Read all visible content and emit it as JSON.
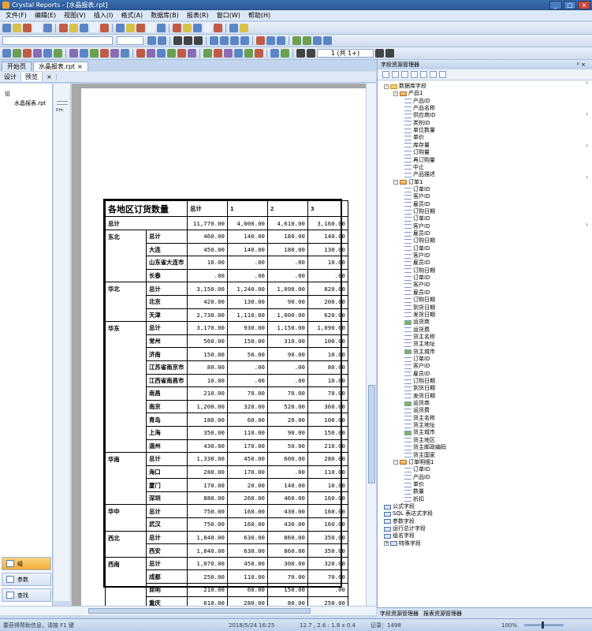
{
  "window": {
    "title": "Crystal Reports - [水晶报表.rpt]",
    "minimize": "_",
    "maximize": "□",
    "close": "×"
  },
  "menu": [
    "文件(F)",
    "编辑(E)",
    "视图(V)",
    "插入(I)",
    "格式(A)",
    "数据库(B)",
    "报表(R)",
    "窗口(W)",
    "帮助(H)"
  ],
  "doc_tabs": [
    {
      "label": "开始页",
      "active": false
    },
    {
      "label": "水晶报表.rpt",
      "active": true,
      "close": "×"
    }
  ],
  "sub_tabs": [
    {
      "label": "设计",
      "active": false
    },
    {
      "label": "预览",
      "active": true,
      "close": "×"
    }
  ],
  "page_nav": {
    "label": "1 (共 1+)"
  },
  "left_panel": {
    "heading": "组",
    "tree_item": "水晶报表.rpt",
    "buttons": [
      {
        "label": "组",
        "active": true
      },
      {
        "label": "参数",
        "active": false
      },
      {
        "label": "查找",
        "active": false
      }
    ]
  },
  "ruler_label": "RHc",
  "report": {
    "title": "各地区订货数量",
    "columns": [
      "总计",
      "1",
      "2",
      "3"
    ],
    "grand_total": {
      "label": "总计",
      "values": [
        "11,770.00",
        "4,000.00",
        "4,610.00",
        "3,160.00"
      ]
    },
    "regions": [
      {
        "name": "东北",
        "rows": [
          {
            "city": "总计",
            "values": [
              "460.00",
              "140.00",
              "180.00",
              "140.00"
            ]
          },
          {
            "city": "大连",
            "values": [
              "450.00",
              "140.00",
              "180.00",
              "130.00"
            ]
          },
          {
            "city": "山东省大连市",
            "values": [
              "10.00",
              ".00",
              ".00",
              "10.00"
            ]
          },
          {
            "city": "长春",
            "values": [
              ".00",
              ".00",
              ".00",
              ".00"
            ]
          }
        ]
      },
      {
        "name": "华北",
        "rows": [
          {
            "city": "总计",
            "values": [
              "3,150.00",
              "1,240.00",
              "1,090.00",
              "820.00"
            ]
          },
          {
            "city": "北京",
            "values": [
              "420.00",
              "130.00",
              "90.00",
              "200.00"
            ]
          },
          {
            "city": "天津",
            "values": [
              "2,730.00",
              "1,110.00",
              "1,000.00",
              "620.00"
            ]
          }
        ]
      },
      {
        "name": "华东",
        "rows": [
          {
            "city": "总计",
            "values": [
              "3,170.00",
              "930.00",
              "1,150.00",
              "1,090.00"
            ]
          },
          {
            "city": "常州",
            "values": [
              "560.00",
              "150.00",
              "310.00",
              "100.00"
            ]
          },
          {
            "city": "济南",
            "values": [
              "150.00",
              "50.00",
              "90.00",
              "10.00"
            ]
          },
          {
            "city": "江苏省南京市",
            "values": [
              "80.00",
              ".00",
              ".00",
              "80.00"
            ]
          },
          {
            "city": "江西省南昌市",
            "values": [
              "10.00",
              ".00",
              ".00",
              "10.00"
            ]
          },
          {
            "city": "南昌",
            "values": [
              "210.00",
              "70.00",
              "70.00",
              "70.00"
            ]
          },
          {
            "city": "南京",
            "values": [
              "1,200.00",
              "320.00",
              "520.00",
              "360.00"
            ]
          },
          {
            "city": "青岛",
            "values": [
              "180.00",
              "60.00",
              "20.00",
              "100.00"
            ]
          },
          {
            "city": "上海",
            "values": [
              "350.00",
              "110.00",
              "90.00",
              "150.00"
            ]
          },
          {
            "city": "温州",
            "values": [
              "430.00",
              "170.00",
              "50.00",
              "210.00"
            ]
          }
        ]
      },
      {
        "name": "华南",
        "rows": [
          {
            "city": "总计",
            "values": [
              "1,330.00",
              "450.00",
              "600.00",
              "280.00"
            ]
          },
          {
            "city": "海口",
            "values": [
              "280.00",
              "170.00",
              ".00",
              "110.00"
            ]
          },
          {
            "city": "厦门",
            "values": [
              "170.00",
              "20.00",
              "140.00",
              "10.00"
            ]
          },
          {
            "city": "深圳",
            "values": [
              "880.00",
              "260.00",
              "460.00",
              "160.00"
            ]
          }
        ]
      },
      {
        "name": "华中",
        "rows": [
          {
            "city": "总计",
            "values": [
              "750.00",
              "160.00",
              "430.00",
              "160.00"
            ]
          },
          {
            "city": "武汉",
            "values": [
              "750.00",
              "160.00",
              "430.00",
              "160.00"
            ]
          }
        ]
      },
      {
        "name": "西北",
        "rows": [
          {
            "city": "总计",
            "values": [
              "1,840.00",
              "630.00",
              "860.00",
              "350.00"
            ]
          },
          {
            "city": "西安",
            "values": [
              "1,840.00",
              "630.00",
              "860.00",
              "350.00"
            ]
          }
        ]
      },
      {
        "name": "西南",
        "rows": [
          {
            "city": "总计",
            "values": [
              "1,070.00",
              "450.00",
              "300.00",
              "320.00"
            ]
          },
          {
            "city": "成都",
            "values": [
              "250.00",
              "110.00",
              "70.00",
              "70.00"
            ]
          },
          {
            "city": "昆明",
            "values": [
              "210.00",
              "60.00",
              "150.00",
              ".00"
            ]
          },
          {
            "city": "重庆",
            "values": [
              "610.00",
              "280.00",
              "80.00",
              "250.00"
            ]
          }
        ]
      }
    ]
  },
  "field_explorer": {
    "title": "字段资源管理器",
    "pin": "ᵖ ×",
    "tree": [
      {
        "label": "数据库字段",
        "level": 0,
        "icon": "db",
        "expand": "-"
      },
      {
        "label": "产品1",
        "level": 1,
        "icon": "tbl",
        "expand": "-"
      },
      {
        "label": "产品ID",
        "level": 2,
        "icon": "fld"
      },
      {
        "label": "产品名称",
        "level": 2,
        "icon": "fld"
      },
      {
        "label": "供应商ID",
        "level": 2,
        "icon": "fld"
      },
      {
        "label": "类别ID",
        "level": 2,
        "icon": "fld"
      },
      {
        "label": "单位数量",
        "level": 2,
        "icon": "fld"
      },
      {
        "label": "单价",
        "level": 2,
        "icon": "fld"
      },
      {
        "label": "库存量",
        "level": 2,
        "icon": "fld"
      },
      {
        "label": "订购量",
        "level": 2,
        "icon": "fld"
      },
      {
        "label": "再订购量",
        "level": 2,
        "icon": "fld"
      },
      {
        "label": "中止",
        "level": 2,
        "icon": "fld"
      },
      {
        "label": "产品描述",
        "level": 2,
        "icon": "fld"
      },
      {
        "label": "订单1",
        "level": 1,
        "icon": "tbl",
        "expand": "-"
      },
      {
        "label": "订单ID",
        "level": 2,
        "icon": "fld"
      },
      {
        "label": "客户ID",
        "level": 2,
        "icon": "fld"
      },
      {
        "label": "雇员ID",
        "level": 2,
        "icon": "fld"
      },
      {
        "label": "订购日期",
        "level": 2,
        "icon": "fld"
      },
      {
        "label": "订单ID",
        "level": 2,
        "icon": "fld"
      },
      {
        "label": "客户ID",
        "level": 2,
        "icon": "fld"
      },
      {
        "label": "雇员ID",
        "level": 2,
        "icon": "fld"
      },
      {
        "label": "订购日期",
        "level": 2,
        "icon": "fld"
      },
      {
        "label": "订单ID",
        "level": 2,
        "icon": "fld"
      },
      {
        "label": "客户ID",
        "level": 2,
        "icon": "fld"
      },
      {
        "label": "雇员ID",
        "level": 2,
        "icon": "fld"
      },
      {
        "label": "订购日期",
        "level": 2,
        "icon": "fld"
      },
      {
        "label": "订单ID",
        "level": 2,
        "icon": "fld"
      },
      {
        "label": "客户ID",
        "level": 2,
        "icon": "fld"
      },
      {
        "label": "雇员ID",
        "level": 2,
        "icon": "fld"
      },
      {
        "label": "订购日期",
        "level": 2,
        "icon": "fld"
      },
      {
        "label": "到货日期",
        "level": 2,
        "icon": "fld"
      },
      {
        "label": "发货日期",
        "level": 2,
        "icon": "fld"
      },
      {
        "label": "运货商",
        "level": 2,
        "icon": "fld",
        "sel": true
      },
      {
        "label": "运货费",
        "level": 2,
        "icon": "fld"
      },
      {
        "label": "货主名称",
        "level": 2,
        "icon": "fld"
      },
      {
        "label": "货主地址",
        "level": 2,
        "icon": "fld"
      },
      {
        "label": "货主城市",
        "level": 2,
        "icon": "fld",
        "sel": true
      },
      {
        "label": "订单ID",
        "level": 2,
        "icon": "fld"
      },
      {
        "label": "客户ID",
        "level": 2,
        "icon": "fld"
      },
      {
        "label": "雇员ID",
        "level": 2,
        "icon": "fld"
      },
      {
        "label": "订购日期",
        "level": 2,
        "icon": "fld"
      },
      {
        "label": "到货日期",
        "level": 2,
        "icon": "fld"
      },
      {
        "label": "发货日期",
        "level": 2,
        "icon": "fld"
      },
      {
        "label": "运货商",
        "level": 2,
        "icon": "fld",
        "sel": true
      },
      {
        "label": "运货费",
        "level": 2,
        "icon": "fld"
      },
      {
        "label": "货主名称",
        "level": 2,
        "icon": "fld"
      },
      {
        "label": "货主地址",
        "level": 2,
        "icon": "fld"
      },
      {
        "label": "货主城市",
        "level": 2,
        "icon": "fld",
        "sel": true
      },
      {
        "label": "货主地区",
        "level": 2,
        "icon": "fld"
      },
      {
        "label": "货主邮政编码",
        "level": 2,
        "icon": "fld"
      },
      {
        "label": "货主国家",
        "level": 2,
        "icon": "fld"
      },
      {
        "label": "订单明细1",
        "level": 1,
        "icon": "tbl",
        "expand": "-"
      },
      {
        "label": "订单ID",
        "level": 2,
        "icon": "fld"
      },
      {
        "label": "产品ID",
        "level": 2,
        "icon": "fld"
      },
      {
        "label": "单价",
        "level": 2,
        "icon": "fld"
      },
      {
        "label": "数量",
        "level": 2,
        "icon": "fld"
      },
      {
        "label": "折扣",
        "level": 2,
        "icon": "fld"
      },
      {
        "label": "公式字段",
        "level": 0,
        "icon": "misc"
      },
      {
        "label": "SQL 表达式字段",
        "level": 0,
        "icon": "misc"
      },
      {
        "label": "参数字段",
        "level": 0,
        "icon": "misc"
      },
      {
        "label": "运行总计字段",
        "level": 0,
        "icon": "misc"
      },
      {
        "label": "组名字段",
        "level": 0,
        "icon": "misc"
      },
      {
        "label": "特殊字段",
        "level": 0,
        "icon": "misc",
        "expand": "+"
      }
    ]
  },
  "bottom_tabs": [
    "字段资源管理器",
    "报表资源管理器"
  ],
  "status": {
    "help": "要获得帮助信息，请按 F1 键",
    "datetime": "2018/5/24  16:25",
    "dims": "12.7 , 2.6 : 1.8 x 0.4",
    "records": "记录：1498",
    "zoom": "100%"
  },
  "colors": {
    "accent": "#3c6fb0",
    "active_button": "#f3ac36",
    "selected_field": "#7fb26a"
  }
}
